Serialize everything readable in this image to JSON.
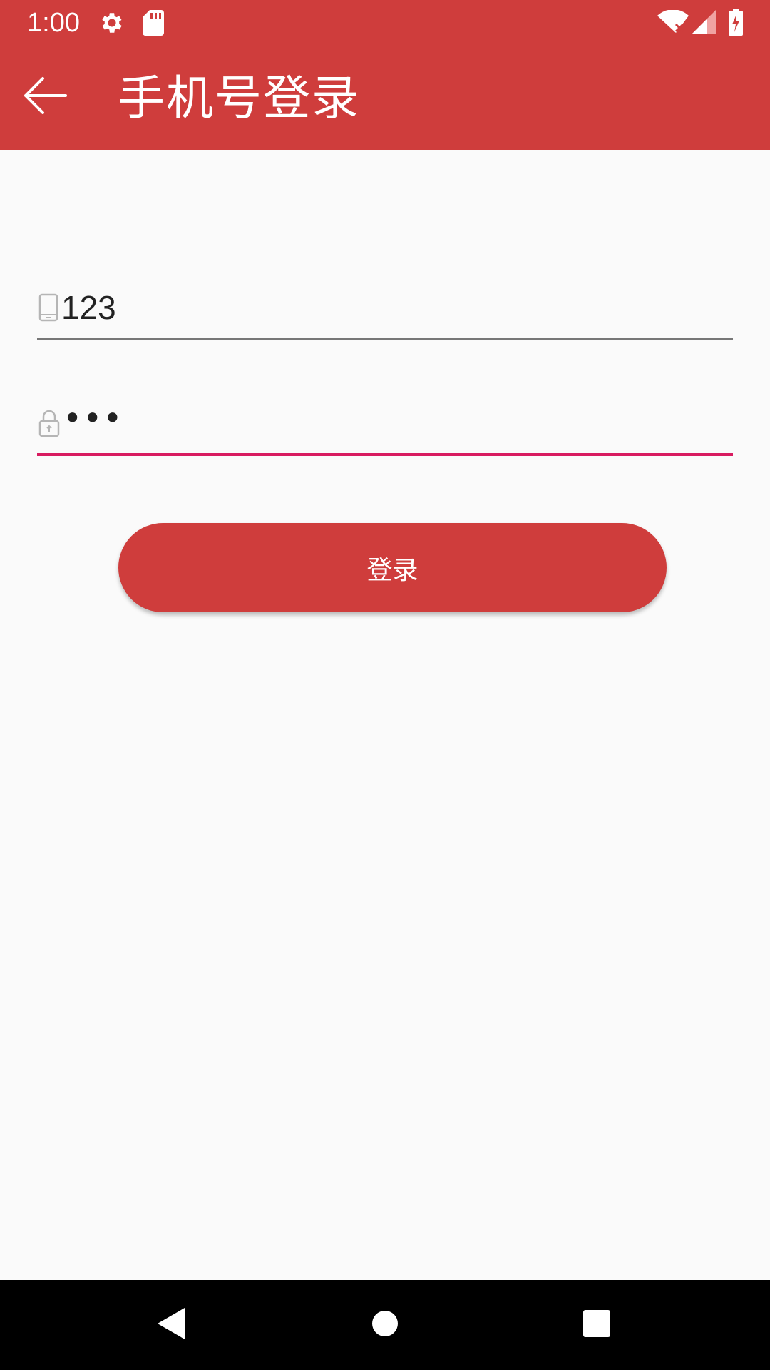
{
  "status_bar": {
    "time": "1:00",
    "icons": [
      "settings-icon",
      "sd-card-icon",
      "wifi-off-icon",
      "signal-icon",
      "battery-charging-icon"
    ]
  },
  "app_bar": {
    "title": "手机号登录",
    "back_icon": "arrow-back-icon",
    "color": "#cf3d3c"
  },
  "form": {
    "phone": {
      "icon": "phone-icon",
      "value": "123"
    },
    "password": {
      "icon": "lock-icon",
      "display": "•••"
    }
  },
  "login_button": {
    "label": "登录"
  },
  "nav_bar": {
    "back": "nav-back-icon",
    "home": "nav-home-icon",
    "recents": "nav-recents-icon"
  },
  "colors": {
    "primary": "#cf3d3c",
    "accent": "#d81b60",
    "background": "#fafafa"
  }
}
